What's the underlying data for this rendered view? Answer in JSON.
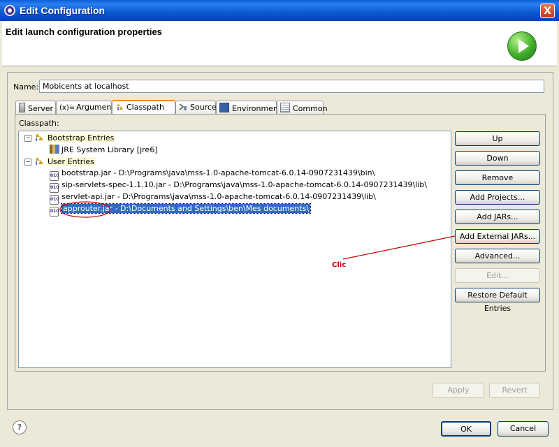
{
  "window": {
    "title": "Edit Configuration",
    "close_glyph": "X"
  },
  "header": {
    "title": "Edit launch configuration properties",
    "icon": "run-icon"
  },
  "name_field": {
    "label": "Name:",
    "value": "Mobicents at localhost"
  },
  "tabs": [
    {
      "label": "Server",
      "icon": "server-icon"
    },
    {
      "label": "Arguments",
      "icon": "arguments-icon",
      "icon_text": "(x)="
    },
    {
      "label": "Classpath",
      "icon": "classpath-icon",
      "active": true
    },
    {
      "label": "Source",
      "icon": "source-icon"
    },
    {
      "label": "Environment",
      "icon": "environment-icon"
    },
    {
      "label": "Common",
      "icon": "common-icon"
    }
  ],
  "classpath": {
    "label": "Classpath:",
    "tree": [
      {
        "label": "Bootstrap Entries",
        "kind": "group"
      },
      {
        "label": "JRE System Library [jre6]",
        "kind": "library"
      },
      {
        "label": "User Entries",
        "kind": "group"
      },
      {
        "label": "bootstrap.jar - D:\\Programs\\java\\mss-1.0-apache-tomcat-6.0.14-0907231439\\bin\\",
        "kind": "jar"
      },
      {
        "label": "sip-servlets-spec-1.1.10.jar - D:\\Programs\\java\\mss-1.0-apache-tomcat-6.0.14-0907231439\\lib\\",
        "kind": "jar"
      },
      {
        "label": "servlet-api.jar - D:\\Programs\\java\\mss-1.0-apache-tomcat-6.0.14-0907231439\\lib\\",
        "kind": "jar"
      },
      {
        "label": "approuter.jar - D:\\Documents and Settings\\ben\\Mes documents\\",
        "kind": "jar",
        "selected": true
      }
    ],
    "jar_icon_text": "010"
  },
  "buttons": {
    "up": "Up",
    "down": "Down",
    "remove": "Remove",
    "add_projects": "Add Projects...",
    "add_jars": "Add JARs...",
    "add_external_jars": "Add External JARs...",
    "advanced": "Advanced...",
    "edit": "Edit...",
    "restore": "Restore Default Entries",
    "apply": "Apply",
    "revert": "Revert",
    "ok": "OK",
    "cancel": "Cancel"
  },
  "annotation": {
    "text": "Clic",
    "color": "#c00000"
  },
  "help": {
    "glyph": "?"
  },
  "colors": {
    "title_bar": "#0a5fd8",
    "selection": "#316ac5",
    "tab_accent": "#e68b2c"
  }
}
